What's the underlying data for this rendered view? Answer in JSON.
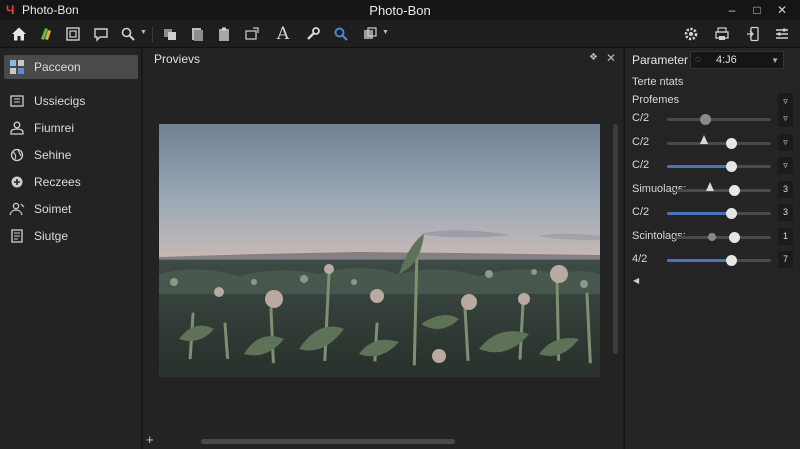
{
  "window": {
    "app_name": "Photo-Bon",
    "title": "Photo-Bon",
    "logo_glyph": "Ч",
    "controls": {
      "minimize": "–",
      "maximize": "□",
      "close": "✕"
    }
  },
  "toolbar": {
    "icons": [
      "home-icon",
      "color-swatch-icon",
      "layers-icon",
      "chat-icon",
      "zoom-icon",
      "stack-icon",
      "copy-icon",
      "clipboard-icon",
      "transform-icon",
      "text-icon",
      "tools-icon",
      "search-icon",
      "export-icon",
      "settings-icon",
      "print-icon",
      "phone-export-icon",
      "adjust-icon"
    ],
    "text_tool_glyph": "A"
  },
  "sidebar": {
    "items": [
      {
        "label": "Pacceon",
        "icon": "grid-icon",
        "active": true
      },
      {
        "label": "Ussiecigs",
        "icon": "panel-icon",
        "active": false
      },
      {
        "label": "Fiumrei",
        "icon": "person-icon",
        "active": false
      },
      {
        "label": "Sehine",
        "icon": "globe-icon",
        "active": false
      },
      {
        "label": "Reczees",
        "icon": "plus-circle-icon",
        "active": false
      },
      {
        "label": "Soimet",
        "icon": "user-icon",
        "active": false
      },
      {
        "label": "Siutge",
        "icon": "document-icon",
        "active": false
      }
    ]
  },
  "preview": {
    "title": "Provievs",
    "pin_glyph": "❖",
    "close_glyph": "✕",
    "add_glyph": "+"
  },
  "parameters": {
    "title": "Parameter",
    "select_icon": "◌",
    "select_value": "4:J6",
    "section_1": "Terte ntats",
    "section_2": "Profemes",
    "section_2_button": "▿",
    "rows": [
      {
        "label": "C/2",
        "value": 0.37,
        "filled": false,
        "knob": "dim",
        "spike": false,
        "button": "▿"
      },
      {
        "label": "C/2",
        "value": 0.62,
        "filled": false,
        "knob": "light",
        "spike": true,
        "spike_at": 0.36,
        "button": "▿"
      },
      {
        "label": "C/2",
        "value": 0.62,
        "filled": true,
        "knob": "light",
        "spike": false,
        "button": "▿"
      },
      {
        "label": "Simuolags:",
        "value": 0.62,
        "filled": false,
        "knob": "light",
        "spike": true,
        "spike_at": 0.36,
        "button": "3"
      },
      {
        "label": "C/2",
        "value": 0.62,
        "filled": true,
        "knob": "light",
        "spike": false,
        "button": "3"
      },
      {
        "label": "Scintolags:",
        "value": 0.62,
        "filled": false,
        "knob": "light",
        "spike": false,
        "button": "1",
        "small_knob_at": 0.39
      },
      {
        "label": "4/2",
        "value": 0.62,
        "filled": true,
        "knob": "light",
        "spike": false,
        "button": "7"
      }
    ],
    "back_glyph": "◀"
  },
  "colors": {
    "accent": "#4b74b8",
    "logo": "#e0443a",
    "sidebar_active": "#4a4a4a",
    "panel_bg": "#242424"
  }
}
